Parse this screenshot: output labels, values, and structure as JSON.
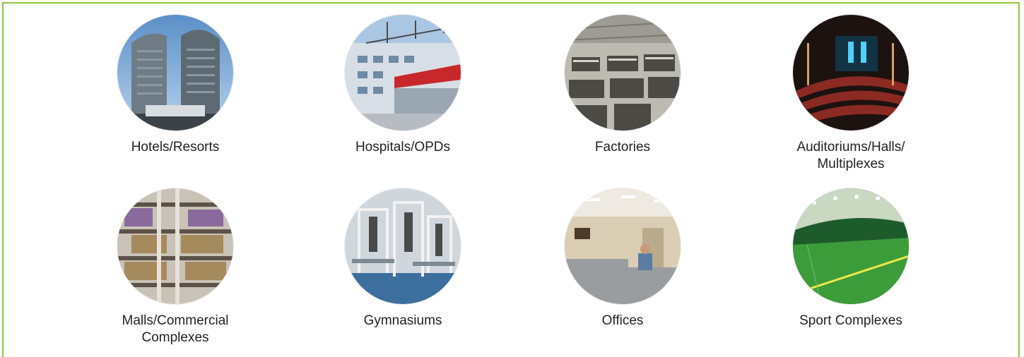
{
  "items": [
    {
      "label": "Hotels/Resorts",
      "image": "hotels-resorts-photo"
    },
    {
      "label": "Hospitals/OPDs",
      "image": "hospitals-opds-photo"
    },
    {
      "label": "Factories",
      "image": "factories-photo"
    },
    {
      "label": "Auditoriums/Halls/\nMultiplexes",
      "label_line1": "Auditoriums/Halls/",
      "label_line2": "Multiplexes",
      "image": "auditoriums-photo"
    },
    {
      "label_line1": "Malls/Commercial",
      "label_line2": "Complexes",
      "image": "malls-photo"
    },
    {
      "label": "Gymnasiums",
      "image": "gymnasiums-photo"
    },
    {
      "label": "Offices",
      "image": "offices-photo"
    },
    {
      "label": "Sport Complexes",
      "image": "sport-complexes-photo"
    }
  ],
  "colors": {
    "border": "#8dc63f",
    "text": "#231f20"
  }
}
